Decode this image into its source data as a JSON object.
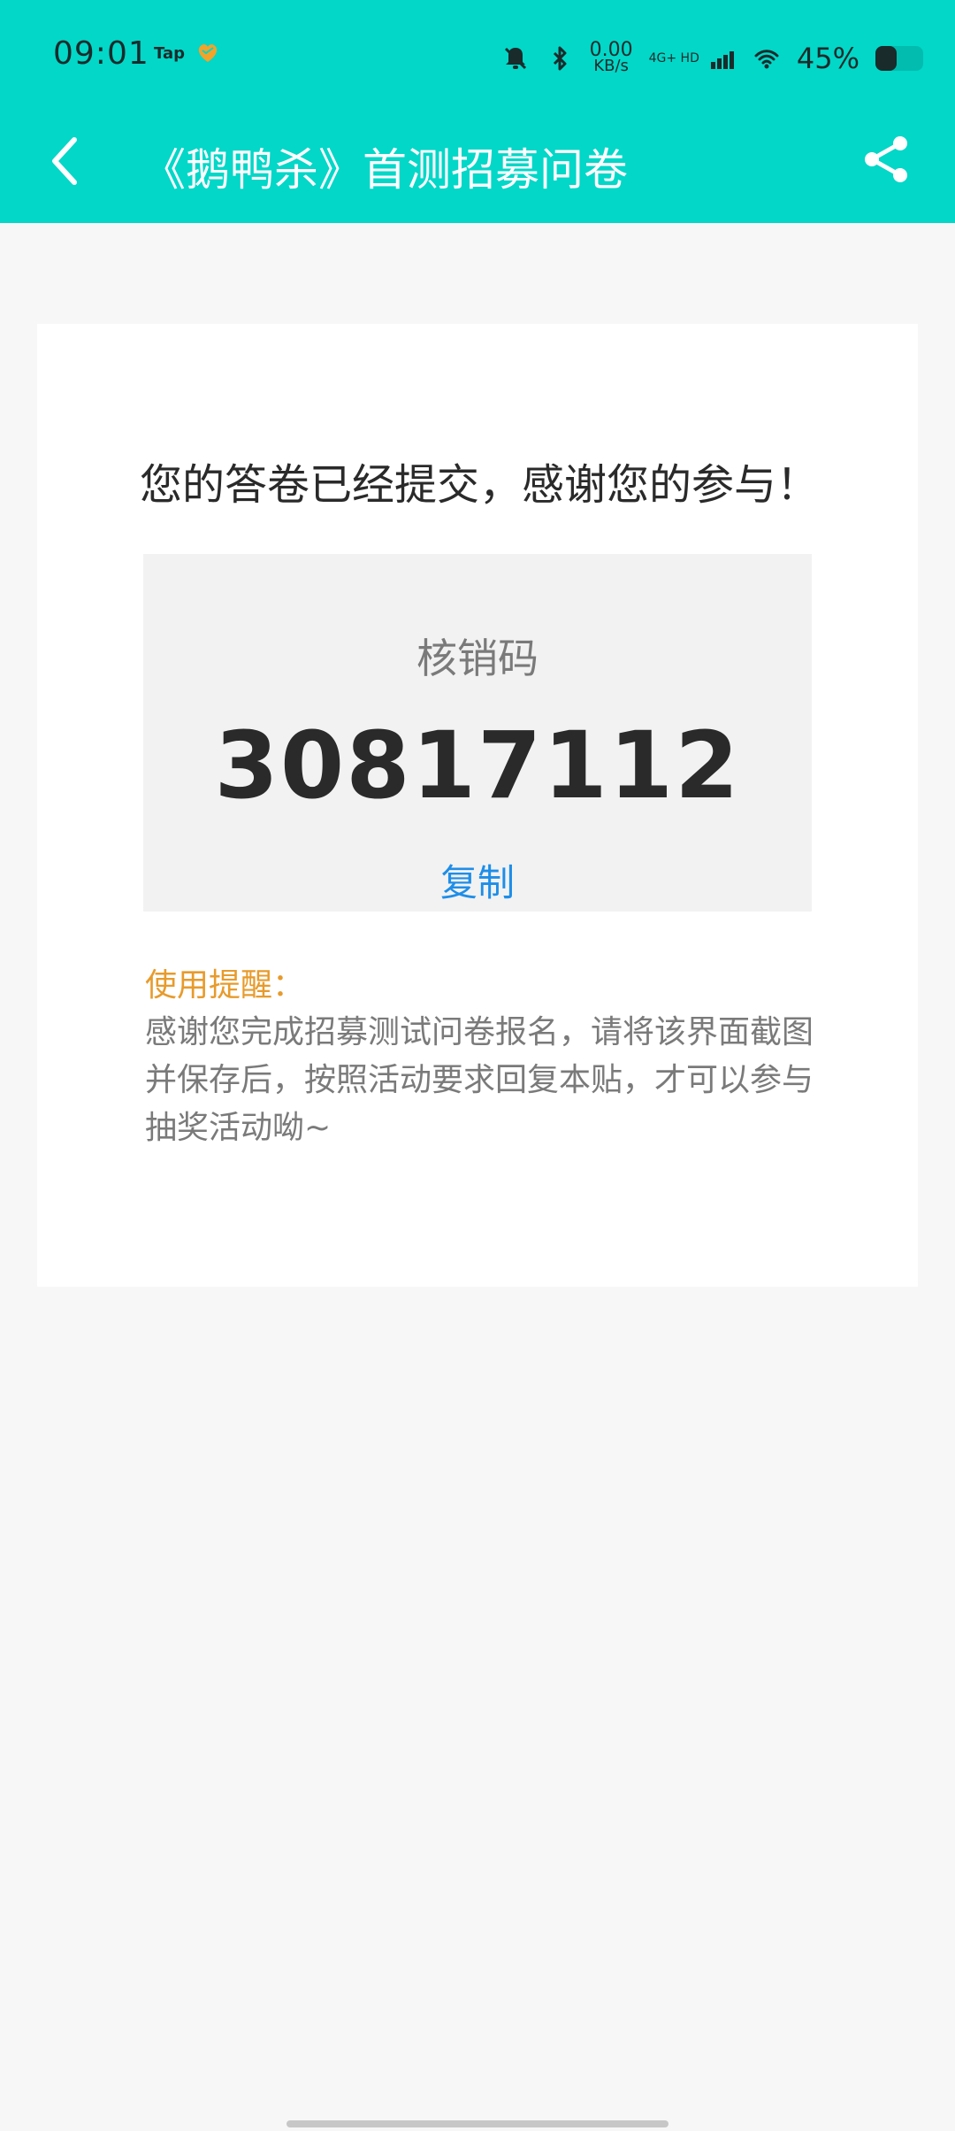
{
  "status_bar": {
    "time": "09:01",
    "tap_label": "Tap",
    "net_speed_value": "0.00",
    "net_speed_unit": "KB/s",
    "network_type": "4G+ HD",
    "battery_percent": "45%",
    "battery_level": 0.45
  },
  "nav": {
    "title": "《鹅鸭杀》首测招募问卷"
  },
  "card": {
    "message": "您的答卷已经提交，感谢您的参与！",
    "code_label": "核销码",
    "code_value": "30817112",
    "copy_label": "复制",
    "reminder_title": "使用提醒：",
    "reminder_text": "感谢您完成招募测试问卷报名，请将该界面截图并保存后，按照活动要求回复本贴，才可以参与抽奖活动呦~"
  },
  "colors": {
    "top_bar": "#02d7c8",
    "link_blue": "#1e8ee8",
    "reminder_orange": "#e79b2c"
  },
  "icons": {
    "back": "back-icon",
    "share": "share-icon",
    "mute": "mute-icon",
    "bluetooth": "bluetooth-icon",
    "wifi": "wifi-icon",
    "signal": "signal-icon",
    "heart": "heart-icon"
  }
}
